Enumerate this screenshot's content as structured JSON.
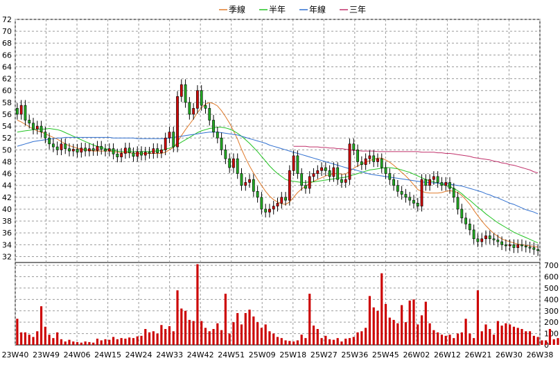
{
  "chart_data": [
    {
      "type": "candlestick",
      "legend": [
        {
          "name": "季線",
          "color": "#e07a2a"
        },
        {
          "name": "半年",
          "color": "#22c322"
        },
        {
          "name": "年線",
          "color": "#2f6fd0"
        },
        {
          "name": "三年",
          "color": "#c0306a"
        }
      ],
      "ylim": [
        31,
        72
      ],
      "yticks": [
        32,
        34,
        36,
        38,
        40,
        42,
        44,
        46,
        48,
        50,
        52,
        54,
        56,
        58,
        60,
        62,
        64,
        66,
        68,
        70,
        72
      ],
      "xticks": [
        "23W40",
        "23W49",
        "24W06",
        "24W15",
        "24W24",
        "24W33",
        "24W42",
        "24W51",
        "25W09",
        "25W18",
        "25W27",
        "25W36",
        "25W45",
        "26W02",
        "26W12",
        "26W21",
        "26W30",
        "26W38"
      ],
      "up_color": "#cc0000",
      "down_color": "#22aa22",
      "grid": true,
      "close": [
        56.0,
        57.5,
        55.0,
        54.5,
        53.5,
        54.0,
        53.0,
        52.0,
        51.0,
        50.5,
        50.0,
        51.0,
        50.2,
        49.8,
        50.1,
        49.6,
        50.3,
        49.8,
        50.2,
        49.9,
        50.6,
        50.1,
        49.8,
        50.2,
        49.3,
        48.8,
        49.4,
        50.3,
        49.5,
        48.9,
        49.7,
        49.1,
        49.6,
        49.4,
        50.2,
        49.5,
        50.0,
        52.0,
        53.0,
        50.5,
        59.0,
        61.0,
        58.0,
        56.0,
        57.0,
        60.0,
        57.5,
        57.0,
        55.0,
        53.0,
        52.0,
        50.0,
        48.5,
        47.0,
        48.5,
        46.0,
        44.0,
        44.5,
        45.0,
        43.0,
        42.0,
        40.0,
        39.5,
        40.0,
        40.5,
        41.0,
        42.0,
        41.5,
        46.5,
        49.0,
        46.0,
        44.0,
        43.5,
        45.5,
        46.0,
        46.5,
        47.0,
        46.5,
        45.5,
        47.0,
        45.0,
        44.5,
        45.0,
        51.0,
        50.0,
        48.0,
        47.5,
        48.5,
        49.0,
        48.0,
        48.5,
        47.0,
        46.0,
        45.0,
        44.0,
        43.0,
        42.5,
        42.0,
        41.5,
        41.0,
        40.5,
        45.0,
        44.0,
        45.0,
        45.5,
        44.5,
        44.0,
        44.5,
        43.5,
        42.0,
        40.0,
        38.5,
        37.5,
        36.5,
        35.0,
        34.5,
        35.0,
        35.5,
        35.0,
        34.8,
        34.5,
        34.0,
        33.8,
        34.0,
        33.5,
        34.0,
        33.8,
        33.6,
        33.5,
        33.2,
        33.0
      ],
      "volume": [
        230,
        110,
        110,
        90,
        70,
        120,
        340,
        160,
        90,
        60,
        110,
        50,
        30,
        45,
        30,
        25,
        20,
        30,
        25,
        20,
        55,
        40,
        50,
        45,
        70,
        50,
        60,
        55,
        65,
        60,
        75,
        80,
        140,
        110,
        120,
        100,
        175,
        140,
        165,
        120,
        480,
        320,
        300,
        220,
        210,
        710,
        210,
        150,
        120,
        140,
        190,
        130,
        450,
        100,
        200,
        280,
        180,
        280,
        310,
        250,
        200,
        150,
        180,
        120,
        100,
        70,
        60,
        40,
        35,
        30,
        40,
        90,
        60,
        450,
        170,
        140,
        60,
        80,
        50,
        45,
        60,
        30,
        55,
        60,
        70,
        110,
        120,
        150,
        430,
        330,
        300,
        630,
        360,
        240,
        220,
        190,
        350,
        200,
        390,
        400,
        180,
        260,
        380,
        190,
        130,
        110,
        90,
        80,
        90,
        60,
        100,
        110,
        230,
        100,
        60,
        480,
        120,
        180,
        140,
        90,
        210,
        170,
        190,
        180,
        160,
        150,
        140,
        120,
        120,
        80,
        70,
        40,
        40,
        140,
        50,
        60,
        60
      ],
      "ma_quarter": [
        55.0,
        54.7,
        54.3,
        53.9,
        53.5,
        53.2,
        53.0,
        52.7,
        52.4,
        52.1,
        51.8,
        51.4,
        51.0,
        50.7,
        50.5,
        50.3,
        50.1,
        50.0,
        49.9,
        49.8,
        49.8,
        49.8,
        49.8,
        49.8,
        49.7,
        49.6,
        49.5,
        49.5,
        49.5,
        49.4,
        49.4,
        49.4,
        49.4,
        49.4,
        49.4,
        49.4,
        49.4,
        49.6,
        50.0,
        50.4,
        51.3,
        52.4,
        53.4,
        54.3,
        55.2,
        56.3,
        57.1,
        57.7,
        58.0,
        57.8,
        57.4,
        56.6,
        55.6,
        54.5,
        53.2,
        51.8,
        50.1,
        48.6,
        47.3,
        46.1,
        45.0,
        44.0,
        43.0,
        42.2,
        41.6,
        41.2,
        40.9,
        40.8,
        41.2,
        42.0,
        42.8,
        43.4,
        43.9,
        44.3,
        44.7,
        45.0,
        45.3,
        45.6,
        45.8,
        46.0,
        46.0,
        45.9,
        45.9,
        46.4,
        46.9,
        47.3,
        47.6,
        47.9,
        48.2,
        48.4,
        48.6,
        48.6,
        48.3,
        47.9,
        47.4,
        46.8,
        46.2,
        45.6,
        44.9,
        44.1,
        43.3,
        43.0,
        42.8,
        42.7,
        42.7,
        42.7,
        42.8,
        43.0,
        43.1,
        43.0,
        42.8,
        42.3,
        41.6,
        40.8,
        39.8,
        38.9,
        38.0,
        37.2,
        36.5,
        35.9,
        35.4,
        35.0,
        34.7,
        34.5,
        34.3,
        34.1,
        34.0,
        33.9,
        33.8,
        33.7,
        33.6
      ],
      "ma_half_year": [
        53.0,
        53.1,
        53.2,
        53.3,
        53.4,
        53.5,
        53.5,
        53.5,
        53.6,
        53.5,
        53.4,
        53.2,
        52.9,
        52.6,
        52.3,
        52.0,
        51.7,
        51.4,
        51.1,
        50.8,
        50.6,
        50.4,
        50.2,
        50.0,
        49.9,
        49.8,
        49.7,
        49.7,
        49.7,
        49.7,
        49.7,
        49.7,
        49.7,
        49.7,
        49.8,
        49.8,
        49.9,
        50.1,
        50.3,
        50.5,
        50.9,
        51.3,
        51.7,
        52.1,
        52.5,
        52.9,
        53.2,
        53.4,
        53.6,
        53.7,
        53.8,
        53.8,
        53.7,
        53.5,
        53.2,
        52.8,
        52.3,
        51.7,
        51.1,
        50.4,
        49.7,
        48.9,
        48.1,
        47.3,
        46.6,
        46.0,
        45.5,
        45.0,
        44.8,
        44.7,
        44.6,
        44.5,
        44.5,
        44.6,
        44.6,
        44.7,
        44.8,
        44.9,
        45.0,
        45.1,
        45.2,
        45.3,
        45.4,
        45.6,
        45.8,
        46.0,
        46.2,
        46.4,
        46.6,
        46.7,
        46.8,
        46.9,
        47.0,
        47.0,
        46.9,
        46.8,
        46.6,
        46.4,
        46.2,
        45.9,
        45.6,
        45.3,
        45.0,
        44.8,
        44.6,
        44.4,
        44.2,
        44.0,
        43.8,
        43.5,
        43.1,
        42.6,
        42.0,
        41.5,
        40.9,
        40.3,
        39.8,
        39.2,
        38.7,
        38.2,
        37.7,
        37.3,
        36.9,
        36.5,
        36.1,
        35.8,
        35.5,
        35.2,
        34.9,
        34.6,
        34.3
      ],
      "ma_year": [
        50.6,
        50.8,
        51.0,
        51.2,
        51.4,
        51.5,
        51.6,
        51.7,
        51.8,
        51.9,
        52.0,
        52.0,
        52.1,
        52.1,
        52.1,
        52.1,
        52.1,
        52.1,
        52.1,
        52.1,
        52.1,
        52.1,
        52.1,
        52.1,
        52.0,
        52.0,
        52.0,
        52.0,
        52.0,
        52.0,
        51.9,
        51.9,
        51.9,
        51.9,
        51.9,
        51.9,
        51.9,
        51.9,
        52.0,
        52.1,
        52.2,
        52.3,
        52.4,
        52.5,
        52.6,
        52.7,
        52.8,
        52.9,
        53.0,
        53.0,
        53.0,
        52.9,
        52.8,
        52.7,
        52.6,
        52.5,
        52.3,
        52.1,
        51.9,
        51.7,
        51.5,
        51.3,
        51.1,
        50.8,
        50.6,
        50.4,
        50.2,
        50.0,
        49.8,
        49.6,
        49.4,
        49.2,
        49.0,
        48.8,
        48.6,
        48.4,
        48.2,
        48.0,
        47.8,
        47.6,
        47.4,
        47.2,
        47.0,
        46.8,
        46.7,
        46.5,
        46.3,
        46.1,
        45.9,
        45.8,
        45.7,
        45.6,
        45.5,
        45.4,
        45.3,
        45.2,
        45.1,
        45.0,
        44.9,
        44.8,
        44.7,
        44.6,
        44.5,
        44.5,
        44.4,
        44.4,
        44.3,
        44.3,
        44.2,
        44.1,
        44.0,
        43.9,
        43.7,
        43.5,
        43.3,
        43.1,
        42.9,
        42.6,
        42.4,
        42.1,
        41.9,
        41.6,
        41.3,
        41.0,
        40.8,
        40.5,
        40.2,
        39.9,
        39.7,
        39.5,
        39.2
      ],
      "ma_three_year": [
        50.6,
        50.6,
        50.6,
        50.6,
        50.5,
        50.5,
        50.5,
        50.4,
        50.4,
        50.3,
        50.3,
        50.2,
        50.2,
        50.1,
        50.0,
        49.9,
        49.9,
        49.8,
        49.8,
        49.8,
        49.8,
        49.7,
        49.7,
        49.7,
        49.7,
        49.7,
        49.7,
        49.7,
        49.7,
        49.7,
        49.7,
        49.7,
        49.6,
        49.6,
        49.6,
        49.6,
        49.5,
        49.5,
        49.4,
        49.4,
        49.3,
        49.2,
        49.1,
        49.0,
        48.9,
        48.7,
        48.6,
        48.5,
        48.4,
        48.3,
        48.1,
        48.0,
        47.8,
        47.7,
        47.5,
        47.4,
        47.2,
        47.0,
        46.8,
        46.6,
        46.3,
        46.1
      ]
    }
  ]
}
